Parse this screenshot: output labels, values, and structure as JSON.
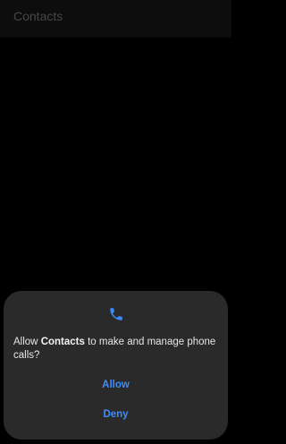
{
  "app_bar": {
    "title": "Contacts"
  },
  "permission_dialog": {
    "icon": "phone-icon",
    "message_prefix": "Allow ",
    "app_name": "Contacts",
    "message_suffix": " to make and manage phone calls?",
    "allow_label": "Allow",
    "deny_label": "Deny"
  },
  "colors": {
    "background": "#000000",
    "dialog_background": "#2a2a2a",
    "accent": "#3d8cff",
    "title_text": "#6e6e6e"
  }
}
